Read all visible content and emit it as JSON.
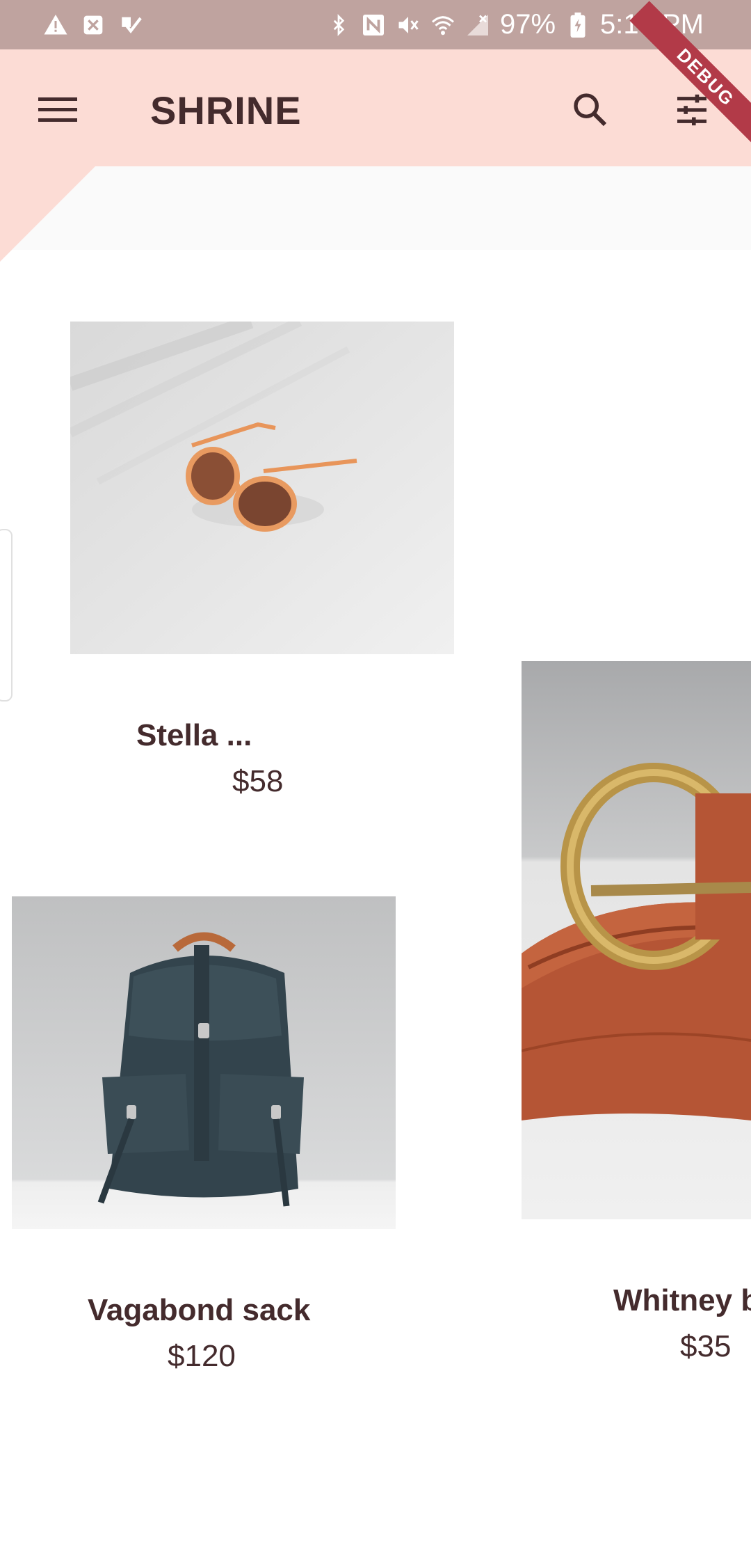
{
  "status_bar": {
    "battery": "97%",
    "time": "5:15 PM",
    "left_icons": [
      "warning-icon",
      "close-box-icon",
      "check-icon"
    ],
    "right_icons": [
      "bluetooth-icon",
      "nfc-icon",
      "mute-icon",
      "wifi-icon",
      "signal-icon",
      "battery-charging-icon"
    ]
  },
  "app_bar": {
    "title": "SHRINE",
    "menu_icon": "menu-icon",
    "search_icon": "search-icon",
    "filter_icon": "tune-icon",
    "background": "#fcdcd5"
  },
  "debug_banner": "DEBUG",
  "products": [
    {
      "name": "Stella ...",
      "price": "$58",
      "image": "sunglasses-image"
    },
    {
      "name": "Vagabond sack",
      "price": "$120",
      "image": "backpack-image"
    },
    {
      "name": "Whitney b",
      "price": "$35",
      "image": "belt-image"
    }
  ],
  "colors": {
    "status_bar": "#bfa39f",
    "text": "#442b2d",
    "debug": "#b23a48"
  }
}
